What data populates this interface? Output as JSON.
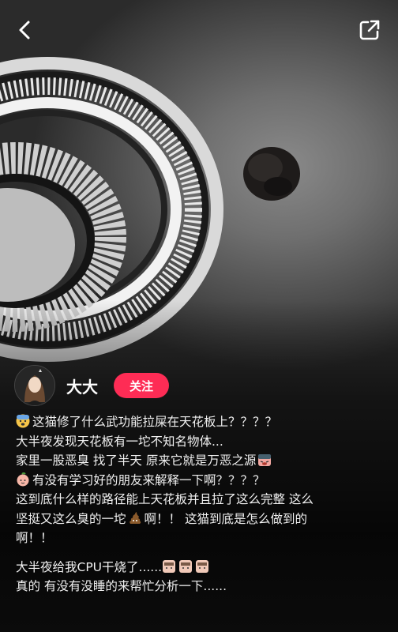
{
  "author": {
    "name": "大大",
    "follow_label": "关注"
  },
  "caption": {
    "line1": "这猫修了什么武功能拉屎在天花板上？？？？",
    "line2": "大半夜发现天花板有一坨不知名物体...",
    "line3": "家里一股恶臭 找了半天 原来它就是万恶之源",
    "line4": "有没有学习好的朋友来解释一下啊？？？？",
    "line5": "这到底什么样的路径能上天花板并且拉了这么完整 这么",
    "line6a": "坚挺又这么臭的一坨",
    "line6b": "啊！！ 这猫到底是怎么做到的",
    "line7": "啊！！",
    "line8": "大半夜给我CPU干烧了......",
    "line9": "真的 有没有没睡的来帮忙分析一下......"
  },
  "icons": {
    "back": "back-arrow-icon",
    "share": "share-external-icon"
  },
  "colors": {
    "follow_button": "#fe2c55",
    "text": "#f1f1f1"
  }
}
